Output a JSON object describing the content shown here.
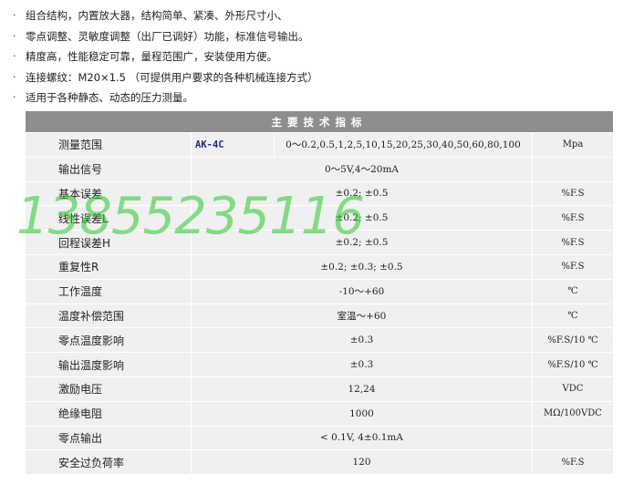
{
  "features": [
    "组合结构，内置放大器，结构简单、紧凑、外形尺寸小、",
    "零点调整、灵敏度调整（出厂已调好）功能，标准信号输出。",
    "精度高，性能稳定可靠，量程范围广，安装使用方便。",
    "连接螺纹：M20×1.5 （可提供用户要求的各种机械连接方式）",
    "适用于各种静态、动态的压力测量。"
  ],
  "bullet": "·",
  "table": {
    "header": "主要技术指标",
    "range_row": {
      "name": "测量范围",
      "model": "AK-4C",
      "value": "0～0.2,0.5,1,2,5,10,15,20,25,30,40,50,60,80,100",
      "unit": "Mpa"
    },
    "rows": [
      {
        "name": "输出信号",
        "value": "0～5V,4～20mA",
        "unit": ""
      },
      {
        "name": "基本误差",
        "value": "±0.2; ±0.5",
        "unit": "%F.S"
      },
      {
        "name": "线性误差L",
        "value": "±0.2; ±0.5",
        "unit": "%F.S"
      },
      {
        "name": "回程误差H",
        "value": "±0.2; ±0.5",
        "unit": "%F.S"
      },
      {
        "name": "重复性R",
        "value": "±0.2; ±0.3; ±0.5",
        "unit": "%F.S"
      },
      {
        "name": "工作温度",
        "value": "-10～+60",
        "unit": "℃"
      },
      {
        "name": "温度补偿范围",
        "value": "室温～+60",
        "unit": "℃"
      },
      {
        "name": "零点温度影响",
        "value": "±0.3",
        "unit": "%F.S/10 ℃"
      },
      {
        "name": "输出温度影响",
        "value": "±0.3",
        "unit": "%F.S/10 ℃"
      },
      {
        "name": "激励电压",
        "value": "12,24",
        "unit": "VDC"
      },
      {
        "name": "绝缘电阻",
        "value": "1000",
        "unit": "MΩ/100VDC"
      },
      {
        "name": "零点输出",
        "value": "< 0.1V, 4±0.1mA",
        "unit": ""
      },
      {
        "name": "安全过负荷率",
        "value": "120",
        "unit": "%F.S"
      }
    ]
  },
  "watermark": "13855235116"
}
